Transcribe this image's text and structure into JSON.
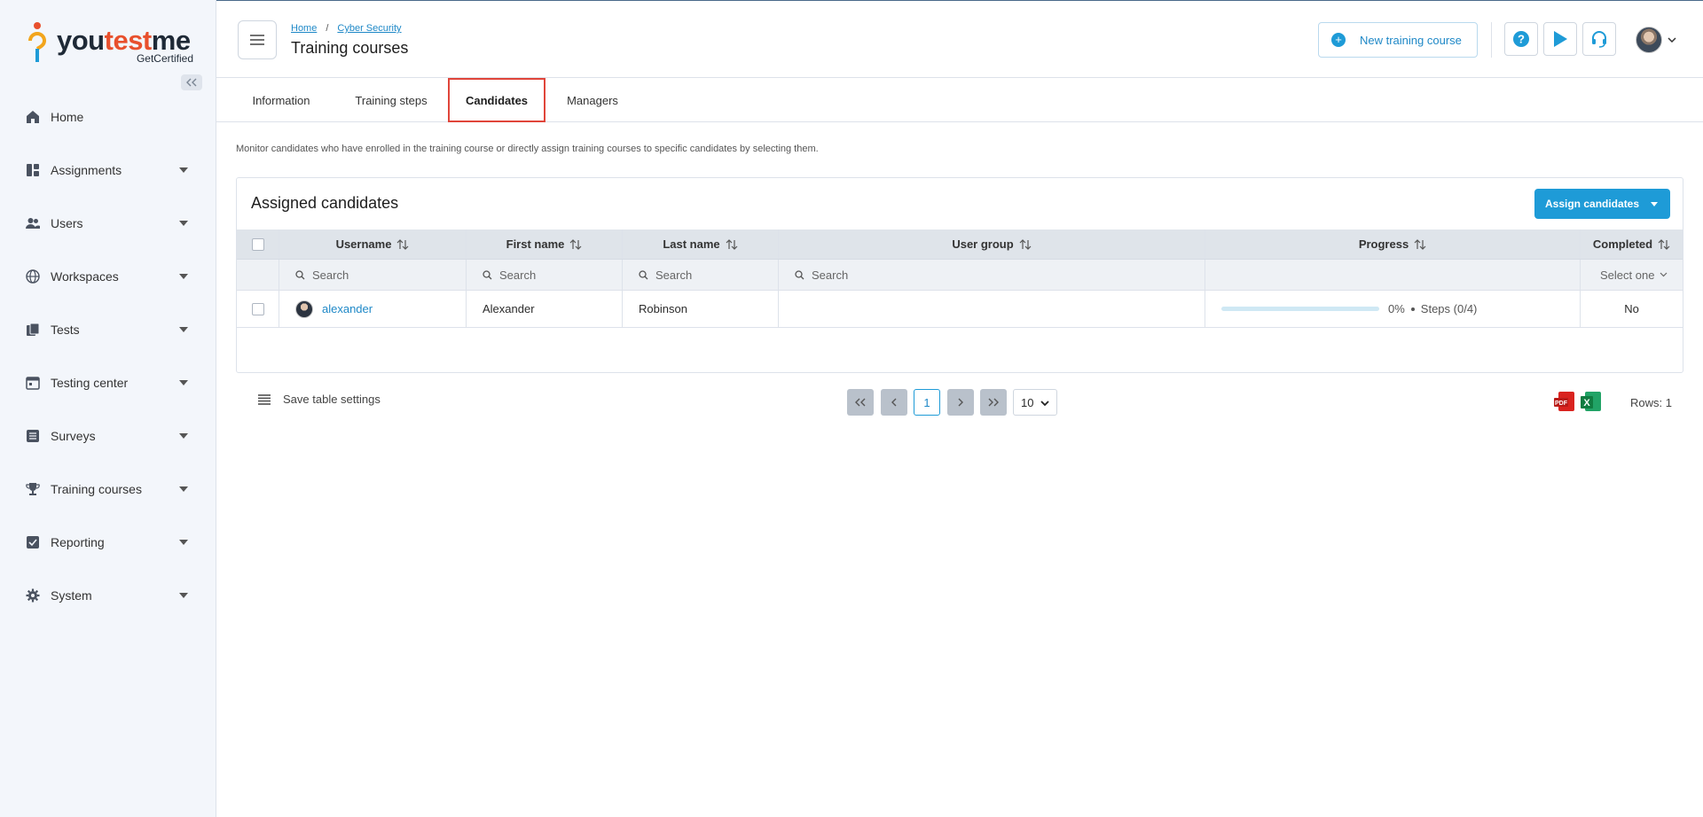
{
  "brand": {
    "name_a": "you",
    "name_b": "test",
    "name_c": "me",
    "sub": "GetCertified"
  },
  "sidebar": {
    "items": [
      {
        "label": "Home",
        "icon": "home-icon",
        "has_caret": false
      },
      {
        "label": "Assignments",
        "icon": "assignments-icon",
        "has_caret": true
      },
      {
        "label": "Users",
        "icon": "users-icon",
        "has_caret": true
      },
      {
        "label": "Workspaces",
        "icon": "globe-icon",
        "has_caret": true
      },
      {
        "label": "Tests",
        "icon": "tests-icon",
        "has_caret": true
      },
      {
        "label": "Testing center",
        "icon": "calendar-icon",
        "has_caret": true
      },
      {
        "label": "Surveys",
        "icon": "surveys-icon",
        "has_caret": true
      },
      {
        "label": "Training courses",
        "icon": "trophy-icon",
        "has_caret": true
      },
      {
        "label": "Reporting",
        "icon": "reporting-icon",
        "has_caret": true
      },
      {
        "label": "System",
        "icon": "gear-icon",
        "has_caret": true
      }
    ]
  },
  "header": {
    "breadcrumb": {
      "home": "Home",
      "separator": "/",
      "parent": "Cyber Security"
    },
    "title": "Training courses",
    "new_course_label": "New training course"
  },
  "tabs": [
    {
      "label": "Information",
      "active": false
    },
    {
      "label": "Training steps",
      "active": false
    },
    {
      "label": "Candidates",
      "active": true
    },
    {
      "label": "Managers",
      "active": false
    }
  ],
  "description": "Monitor candidates who have enrolled in the training course or directly assign training courses to specific candidates by selecting them.",
  "card": {
    "title": "Assigned candidates",
    "assign_label": "Assign candidates"
  },
  "table": {
    "columns": [
      "Username",
      "First name",
      "Last name",
      "User group",
      "Progress",
      "Completed"
    ],
    "filters": {
      "search_placeholder": "Search",
      "select_placeholder": "Select one"
    },
    "rows": [
      {
        "username": "alexander",
        "first_name": "Alexander",
        "last_name": "Robinson",
        "user_group": "",
        "progress_pct": 0,
        "progress_label": "0%",
        "steps": "Steps (0/4)",
        "completed": "No"
      }
    ],
    "footer": {
      "save_settings": "Save table settings",
      "current_page": "1",
      "page_size": "10",
      "rows_label": "Rows: 1"
    }
  },
  "colors": {
    "accent": "#1e9bd7",
    "highlight": "#e0453a",
    "sidebar_bg": "#f3f6fb"
  }
}
